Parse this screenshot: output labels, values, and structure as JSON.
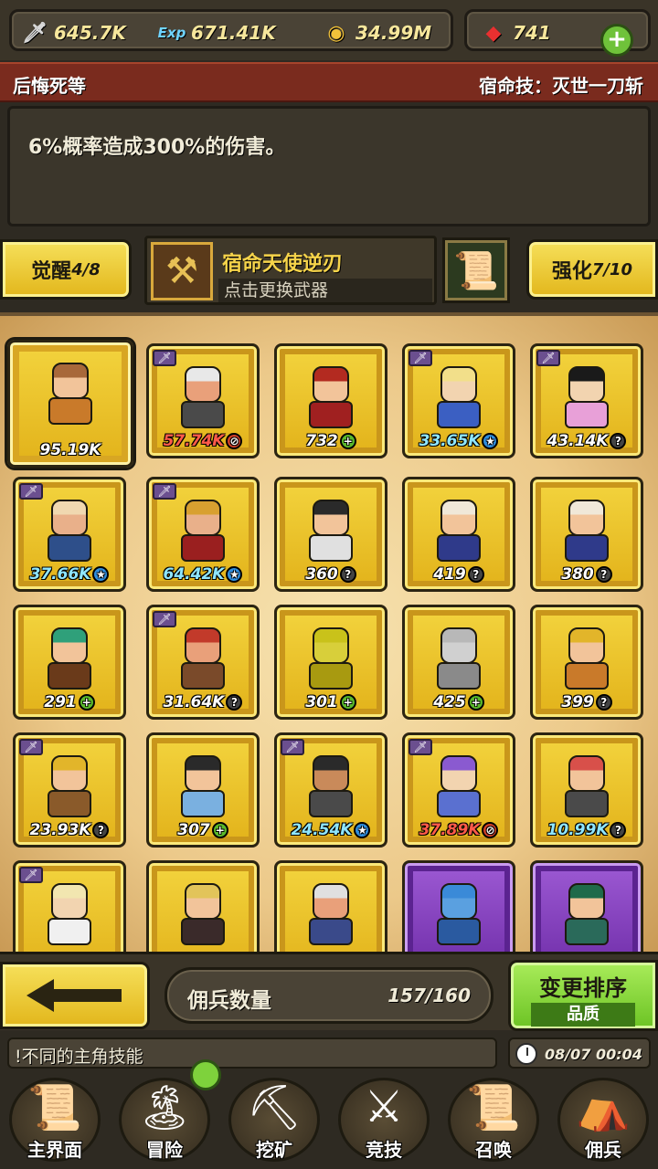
{
  "resources": {
    "attack": {
      "icon": "sword-icon",
      "value": "645.7K"
    },
    "exp": {
      "icon": "exp-icon",
      "label": "Exp",
      "value": "671.41K"
    },
    "gold": {
      "icon": "coin-icon",
      "value": "34.99M"
    },
    "gems": {
      "icon": "ruby-icon",
      "value": "741"
    }
  },
  "skill": {
    "hero_name": "后悔死等",
    "skill_title": "宿命技：灭世一刀斩",
    "description": "6%概率造成300%的伤害。"
  },
  "weapon": {
    "awaken_label": "觉醒",
    "awaken_value": "4/8",
    "name": "宿命天使逆刃",
    "hint": "点击更换武器",
    "enhance_label": "强化",
    "enhance_value": "7/10"
  },
  "heroes": [
    {
      "value": "95.19K",
      "color": "white",
      "badge": "",
      "hair": "#a8683a",
      "skin": "#f2c49a",
      "cloth": "#c97a2a",
      "sword": false
    },
    {
      "value": "57.74K",
      "color": "red",
      "badge": "no",
      "hair": "#e8e8e8",
      "skin": "#e9a07a",
      "cloth": "#4a4a4a",
      "sword": true
    },
    {
      "value": "732",
      "color": "white",
      "badge": "plus",
      "hair": "#b32a20",
      "skin": "#f2c49a",
      "cloth": "#a02020",
      "sword": false
    },
    {
      "value": "33.65K",
      "color": "blue",
      "badge": "star",
      "hair": "#f2df8a",
      "skin": "#f2d4b0",
      "cloth": "#3b5fc2",
      "sword": true
    },
    {
      "value": "43.14K",
      "color": "white",
      "badge": "q",
      "hair": "#1a1a1a",
      "skin": "#f2d4b0",
      "cloth": "#e8a0d8",
      "sword": true
    },
    {
      "value": "37.66K",
      "color": "blue",
      "badge": "star",
      "hair": "#f0d8b0",
      "skin": "#e9b08a",
      "cloth": "#2e4f8a",
      "sword": true
    },
    {
      "value": "64.42K",
      "color": "blue",
      "badge": "star",
      "hair": "#d8a030",
      "skin": "#e9b08a",
      "cloth": "#9a1f1f",
      "sword": true
    },
    {
      "value": "360",
      "color": "white",
      "badge": "q",
      "hair": "#2a2a2a",
      "skin": "#f2c49a",
      "cloth": "#e0e0e0",
      "sword": false
    },
    {
      "value": "419",
      "color": "white",
      "badge": "q",
      "hair": "#f0e8d8",
      "skin": "#f2c49a",
      "cloth": "#2f3a8a",
      "sword": false
    },
    {
      "value": "380",
      "color": "white",
      "badge": "q",
      "hair": "#f0e8d8",
      "skin": "#f2c49a",
      "cloth": "#2f3a8a",
      "sword": false
    },
    {
      "value": "291",
      "color": "white",
      "badge": "plus",
      "hair": "#2fa07a",
      "skin": "#f2c49a",
      "cloth": "#6a3a1a",
      "sword": false
    },
    {
      "value": "31.64K",
      "color": "white",
      "badge": "q",
      "hair": "#c23a2a",
      "skin": "#e9a07a",
      "cloth": "#7a4a2a",
      "sword": true
    },
    {
      "value": "301",
      "color": "white",
      "badge": "plus",
      "hair": "#c9c21a",
      "skin": "#d8cf3a",
      "cloth": "#a89a10",
      "sword": false
    },
    {
      "value": "425",
      "color": "white",
      "badge": "plus",
      "hair": "#b8b8b8",
      "skin": "#d0d0d0",
      "cloth": "#8a8a8a",
      "sword": false
    },
    {
      "value": "399",
      "color": "white",
      "badge": "q",
      "hair": "#e2b52a",
      "skin": "#f2c49a",
      "cloth": "#c97a2a",
      "sword": false
    },
    {
      "value": "23.93K",
      "color": "white",
      "badge": "q",
      "hair": "#e2b52a",
      "skin": "#f2c49a",
      "cloth": "#8a5a2a",
      "sword": true
    },
    {
      "value": "307",
      "color": "white",
      "badge": "plus",
      "hair": "#2a2a2a",
      "skin": "#f2c49a",
      "cloth": "#7ab0e0",
      "sword": false
    },
    {
      "value": "24.54K",
      "color": "blue",
      "badge": "star",
      "hair": "#2a2a2a",
      "skin": "#c98a5a",
      "cloth": "#4a4a4a",
      "sword": true
    },
    {
      "value": "37.89K",
      "color": "red",
      "badge": "no",
      "hair": "#8a5ad0",
      "skin": "#f2d4b0",
      "cloth": "#5a70d0",
      "sword": true
    },
    {
      "value": "10.99K",
      "color": "blue",
      "badge": "q",
      "hair": "#d8504a",
      "skin": "#f2c49a",
      "cloth": "#4a4a4a",
      "sword": false
    },
    {
      "value": "",
      "color": "red",
      "badge": "",
      "hair": "#f2e6b0",
      "skin": "#f2d4b0",
      "cloth": "#f0f0f0",
      "sword": true
    },
    {
      "value": "",
      "color": "white",
      "badge": "",
      "hair": "#e2c45a",
      "skin": "#f2c49a",
      "cloth": "#3a2a2a",
      "sword": false
    },
    {
      "value": "",
      "color": "red",
      "badge": "",
      "hair": "#e0e0e0",
      "skin": "#e9a07a",
      "cloth": "#3a4a8a",
      "sword": false
    },
    {
      "value": "",
      "color": "blue",
      "badge": "",
      "hair": "#3a8ad8",
      "skin": "#5aa0e0",
      "cloth": "#2a5aa0",
      "sword": false,
      "purple": true
    },
    {
      "value": "",
      "color": "blue",
      "badge": "",
      "hair": "#1f6a4a",
      "skin": "#f2c49a",
      "cloth": "#2a6a5a",
      "sword": false,
      "purple": true
    }
  ],
  "roster": {
    "count_label": "佣兵数量",
    "count_value": "157/160",
    "sort_label": "变更排序",
    "sort_mode": "品质"
  },
  "message": "!不同的主角技能",
  "time": "08/07 00:04",
  "nav": [
    {
      "label": "主界面",
      "icon": "map-scroll-icon",
      "glyph": "📜"
    },
    {
      "label": "冒险",
      "icon": "island-icon",
      "glyph": "🏝"
    },
    {
      "label": "挖矿",
      "icon": "pickaxe-icon",
      "glyph": "⛏"
    },
    {
      "label": "竞技",
      "icon": "crossed-swords-icon",
      "glyph": "⚔"
    },
    {
      "label": "召唤",
      "icon": "summon-scroll-icon",
      "glyph": "📜"
    },
    {
      "label": "佣兵",
      "icon": "tent-icon",
      "glyph": "⛺"
    }
  ]
}
